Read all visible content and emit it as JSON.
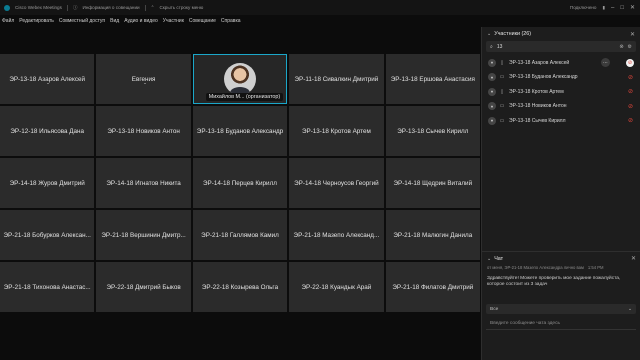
{
  "titlebar": {
    "app_name": "Cisco Webex Meetings",
    "info": "Информация о совещании",
    "hide_menu": "Скрыть строку меню",
    "connected": "Подключено",
    "minimize_icon": "minimize-icon",
    "maximize_icon": "maximize-icon",
    "close_icon": "close-icon"
  },
  "menu": [
    "Файл",
    "Редактировать",
    "Совместный доступ",
    "Вид",
    "Аудио и видео",
    "Участник",
    "Совещание",
    "Справка"
  ],
  "grid": {
    "tiles": [
      "ЭР-13-18 Азаров Алексей",
      "Евгения",
      "",
      "ЭР-11-18 Сивалкин Дмитрий",
      "ЭР-13-18 Ершова Анастасия",
      "ЭР-12-18 Ильясова Дана",
      "ЭР-13-18 Новиков Антон",
      "ЭР-13-18 Буданов Александр",
      "ЭР-13-18 Кротов Артем",
      "ЭР-13-18 Сычев Кирилл",
      "ЭР-14-18 Журов Дмитрий",
      "ЭР-14-18 Игнатов Никита",
      "ЭР-14-18 Перцев Кирилл",
      "ЭР-14-18 Черноусов Георгий",
      "ЭР-14-18 Щедрин Виталий",
      "ЭР-21-18 Бобурков Алексан...",
      "ЭР-21-18 Вершинин Дмитр...",
      "ЭР-21-18 Галлямов Камил",
      "ЭР-21-18 Мазепо Александ...",
      "ЭР-21-18 Малюгин Данила",
      "ЭР-21-18 Тихонова Анастас...",
      "ЭР-22-18 Дмитрий Быков",
      "ЭР-22-18 Козырева Ольга",
      "ЭР-22-18 Куандык Арай",
      "ЭР-21-18 Филатов Дмитрий"
    ],
    "host_label": "Михайлов М... (организатор)"
  },
  "participants": {
    "header": "Участники (26)",
    "search_value": "13",
    "list": [
      {
        "name": "ЭР-13-18 Азаров Алексей",
        "device": "phone"
      },
      {
        "name": "ЭР-13-18 Буданов Александр",
        "device": "computer"
      },
      {
        "name": "ЭР-13-18 Кротов Артем",
        "device": "phone"
      },
      {
        "name": "ЭР-13-18 Новиков Антон",
        "device": "computer"
      },
      {
        "name": "ЭР-13-18 Сычев Кирилл",
        "device": "computer"
      }
    ]
  },
  "chat": {
    "header": "Чат",
    "meta_from": "от меня, ЭР-21-18 Мазепо Александра лично вам",
    "meta_time": "1:54 PM",
    "message": "Здравствуйте! Можете проверить мое задание пожалуйста, которое состоит из 3 задач",
    "to_label": "Все",
    "input_placeholder": "Введите сообщение чата здесь"
  },
  "colors": {
    "active_border": "#1ba7c9",
    "mic_off": "#e0453b"
  }
}
